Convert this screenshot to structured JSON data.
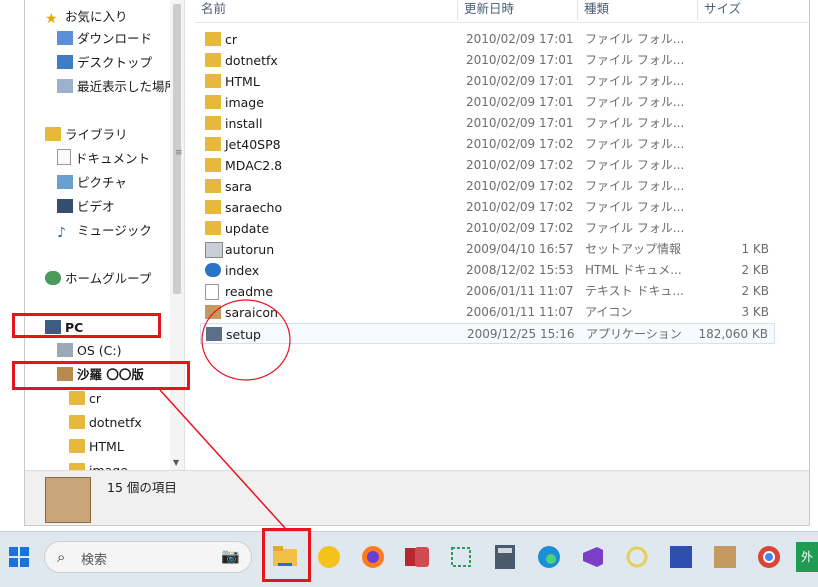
{
  "nav": {
    "favorites": "お気に入り",
    "downloads": "ダウンロード",
    "desktop": "デスクトップ",
    "recent": "最近表示した場所",
    "libraries": "ライブラリ",
    "documents": "ドキュメント",
    "pictures": "ピクチャ",
    "videos": "ビデオ",
    "music": "ミュージック",
    "homegroup": "ホームグループ",
    "pc": "PC",
    "os_drive": "OS (C:)",
    "disc": "沙羅 〇〇版",
    "sub": [
      "cr",
      "dotnetfx",
      "HTML",
      "image"
    ]
  },
  "columns": {
    "name": "名前",
    "date": "更新日時",
    "type": "種類",
    "size": "サイズ"
  },
  "files": [
    {
      "name": "cr",
      "date": "2010/02/09 17:01",
      "type": "ファイル フォル...",
      "size": "",
      "icon": "folder-icon"
    },
    {
      "name": "dotnetfx",
      "date": "2010/02/09 17:01",
      "type": "ファイル フォル...",
      "size": "",
      "icon": "folder-icon"
    },
    {
      "name": "HTML",
      "date": "2010/02/09 17:01",
      "type": "ファイル フォル...",
      "size": "",
      "icon": "folder-icon"
    },
    {
      "name": "image",
      "date": "2010/02/09 17:01",
      "type": "ファイル フォル...",
      "size": "",
      "icon": "folder-icon"
    },
    {
      "name": "install",
      "date": "2010/02/09 17:01",
      "type": "ファイル フォル...",
      "size": "",
      "icon": "folder-icon"
    },
    {
      "name": "Jet40SP8",
      "date": "2010/02/09 17:02",
      "type": "ファイル フォル...",
      "size": "",
      "icon": "folder-icon"
    },
    {
      "name": "MDAC2.8",
      "date": "2010/02/09 17:02",
      "type": "ファイル フォル...",
      "size": "",
      "icon": "folder-icon"
    },
    {
      "name": "sara",
      "date": "2010/02/09 17:02",
      "type": "ファイル フォル...",
      "size": "",
      "icon": "folder-icon"
    },
    {
      "name": "saraecho",
      "date": "2010/02/09 17:02",
      "type": "ファイル フォル...",
      "size": "",
      "icon": "folder-icon"
    },
    {
      "name": "update",
      "date": "2010/02/09 17:02",
      "type": "ファイル フォル...",
      "size": "",
      "icon": "folder-icon"
    },
    {
      "name": "autorun",
      "date": "2009/04/10 16:57",
      "type": "セットアップ情報",
      "size": "1 KB",
      "icon": "setup-info-icon"
    },
    {
      "name": "index",
      "date": "2008/12/02 15:53",
      "type": "HTML ドキュメ...",
      "size": "2 KB",
      "icon": "ie-icon"
    },
    {
      "name": "readme",
      "date": "2006/01/11 11:07",
      "type": "テキスト ドキュ...",
      "size": "2 KB",
      "icon": "text-file-icon"
    },
    {
      "name": "saraicon",
      "date": "2006/01/11 11:07",
      "type": "アイコン",
      "size": "3 KB",
      "icon": "sara-icon"
    },
    {
      "name": "setup",
      "date": "2009/12/25 15:16",
      "type": "アプリケーション",
      "size": "182,060 KB",
      "icon": "setup-app-icon"
    }
  ],
  "status": {
    "count": "15 個の項目"
  },
  "taskbar": {
    "search_placeholder": "検索",
    "extra_label": "外"
  },
  "colors": {
    "annotation_red": "#e8141c",
    "folder": "#e8b83e",
    "selection": "#cde4f7"
  }
}
